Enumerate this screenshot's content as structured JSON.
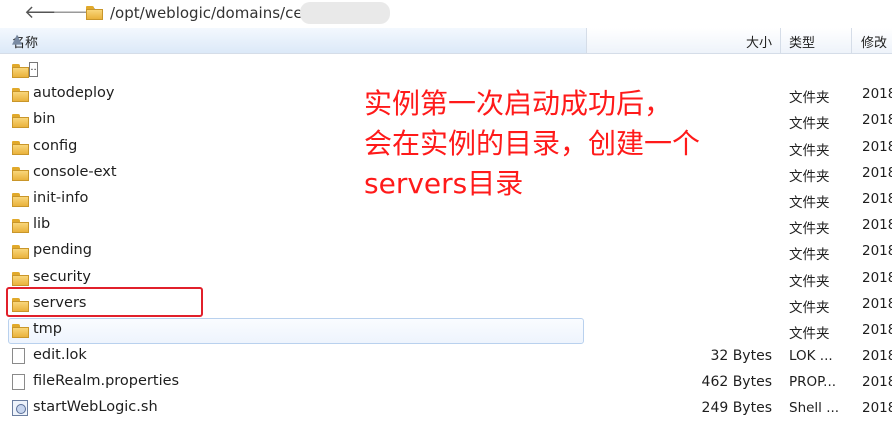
{
  "addressbar": {
    "path": "/opt/weblogic/domains/ce"
  },
  "columns": {
    "name": "名称",
    "size": "大小",
    "type": "类型",
    "modified": "修改"
  },
  "rows": [
    {
      "name": "..",
      "size": "",
      "type": "",
      "modified": "",
      "icon": "parent-folder-icon"
    },
    {
      "name": "autodeploy",
      "size": "",
      "type": "文件夹",
      "modified": "2018",
      "icon": "folder-icon"
    },
    {
      "name": "bin",
      "size": "",
      "type": "文件夹",
      "modified": "2018",
      "icon": "folder-icon"
    },
    {
      "name": "config",
      "size": "",
      "type": "文件夹",
      "modified": "2018",
      "icon": "folder-icon"
    },
    {
      "name": "console-ext",
      "size": "",
      "type": "文件夹",
      "modified": "2018",
      "icon": "folder-icon"
    },
    {
      "name": "init-info",
      "size": "",
      "type": "文件夹",
      "modified": "2018",
      "icon": "folder-icon"
    },
    {
      "name": "lib",
      "size": "",
      "type": "文件夹",
      "modified": "2018",
      "icon": "folder-icon"
    },
    {
      "name": "pending",
      "size": "",
      "type": "文件夹",
      "modified": "2018",
      "icon": "folder-icon"
    },
    {
      "name": "security",
      "size": "",
      "type": "文件夹",
      "modified": "2018",
      "icon": "folder-icon"
    },
    {
      "name": "servers",
      "size": "",
      "type": "文件夹",
      "modified": "2018",
      "icon": "folder-icon"
    },
    {
      "name": "tmp",
      "size": "",
      "type": "文件夹",
      "modified": "2018",
      "icon": "folder-icon"
    },
    {
      "name": "edit.lok",
      "size": "32 Bytes",
      "type": "LOK ...",
      "modified": "2018",
      "icon": "file-icon"
    },
    {
      "name": "fileRealm.properties",
      "size": "462 Bytes",
      "type": "PROP...",
      "modified": "2018",
      "icon": "file-icon"
    },
    {
      "name": "startWebLogic.sh",
      "size": "249 Bytes",
      "type": "Shell ...",
      "modified": "2018",
      "icon": "shell-script-icon"
    }
  ],
  "annotation": {
    "line1": "实例第一次启动成功后，",
    "line2": "会在实例的目录，创建一个",
    "line3": "servers目录",
    "color": "#ff1a1a"
  },
  "colors": {
    "highlight_border": "#e1202b",
    "header_bg": "#dce9f8"
  }
}
